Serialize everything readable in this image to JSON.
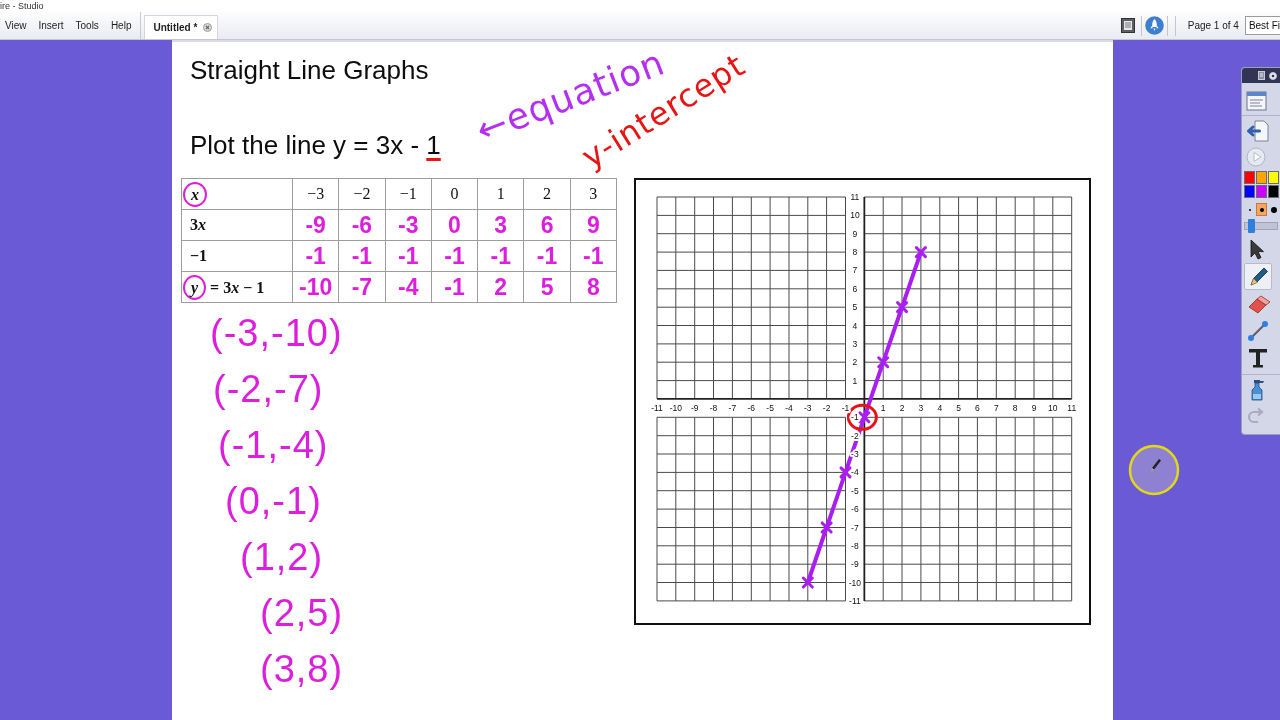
{
  "window": {
    "title": "ire - Studio"
  },
  "menu": [
    "View",
    "Insert",
    "Tools",
    "Help"
  ],
  "tabs": [
    {
      "label": "Untitled *",
      "selected": true
    }
  ],
  "page_indicator": "Page 1 of 4",
  "zoom_field": {
    "value": "Best Fi"
  },
  "page": {
    "title": "Straight Line Graphs",
    "instruction": {
      "parts": [
        {
          "text": "Plot the line y = 3x - ",
          "underlined": false
        },
        {
          "text": "1",
          "underlined": true
        }
      ]
    },
    "annotations": [
      {
        "text": "←equation",
        "color": "#b52ff0"
      },
      {
        "text": "y-intercept",
        "color": "#e81414"
      }
    ],
    "table": {
      "header": {
        "label": [
          {
            "text": "x",
            "kind": "variable",
            "circled": true
          }
        ],
        "values": [
          "−3",
          "−2",
          "−1",
          "0",
          "1",
          "2",
          "3"
        ]
      },
      "rows": [
        {
          "label": [
            {
              "text": "3",
              "kind": "constant",
              "circled": false
            },
            {
              "text": "x",
              "kind": "variable",
              "circled": false
            }
          ],
          "values": [
            "-9",
            "-6",
            "-3",
            "0",
            "3",
            "6",
            "9"
          ]
        },
        {
          "label": [
            {
              "text": "−1",
              "kind": "constant",
              "circled": false
            }
          ],
          "values": [
            "-1",
            "-1",
            "-1",
            "-1",
            "-1",
            "-1",
            "-1"
          ]
        },
        {
          "label": [
            {
              "text": "y",
              "kind": "variable",
              "circled": true
            },
            {
              "text": " = 3",
              "kind": "constant",
              "circled": false
            },
            {
              "text": "x",
              "kind": "variable",
              "circled": false
            },
            {
              "text": " − 1",
              "kind": "constant",
              "circled": false
            }
          ],
          "values": [
            "-10",
            "-7",
            "-4",
            "-1",
            "2",
            "5",
            "8"
          ]
        }
      ]
    },
    "points": [
      "(-3,-10)",
      "(-2,-7)",
      "(-1,-4)",
      "(0,-1)",
      "(1,2)",
      "(2,5)",
      "(3,8)"
    ],
    "graph": {
      "intercept_mark": {
        "color": "#e81414"
      },
      "chart_data": {
        "type": "line",
        "grid": true,
        "x": [
          -3,
          -2,
          -1,
          0,
          1,
          2,
          3
        ],
        "series": [
          {
            "color": "#aa1ef0",
            "marker": "x",
            "values": [
              -10,
              -7,
              -4,
              -1,
              2,
              5,
              8
            ]
          }
        ],
        "xlim": [
          -11,
          11
        ],
        "ylim": [
          -11,
          11
        ],
        "xticks": [
          {
            "value": -11,
            "label": "-11"
          },
          {
            "value": -10,
            "label": "-10"
          },
          {
            "value": -9,
            "label": "-9"
          },
          {
            "value": -8,
            "label": "-8"
          },
          {
            "value": -7,
            "label": "-7"
          },
          {
            "value": -6,
            "label": "-6"
          },
          {
            "value": -5,
            "label": "-5"
          },
          {
            "value": -4,
            "label": "-4"
          },
          {
            "value": -3,
            "label": "-3"
          },
          {
            "value": -2,
            "label": "-2"
          },
          {
            "value": -1,
            "label": "-1"
          },
          {
            "value": 1,
            "label": "1"
          },
          {
            "value": 2,
            "label": "2"
          },
          {
            "value": 3,
            "label": "3"
          },
          {
            "value": 4,
            "label": "4"
          },
          {
            "value": 5,
            "label": "5"
          },
          {
            "value": 6,
            "label": "6"
          },
          {
            "value": 7,
            "label": "7"
          },
          {
            "value": 8,
            "label": "8"
          },
          {
            "value": 9,
            "label": "9"
          },
          {
            "value": 10,
            "label": "10"
          },
          {
            "value": 11,
            "label": "11"
          }
        ],
        "yticks": [
          {
            "value": -11,
            "label": "-11"
          },
          {
            "value": -10,
            "label": "-10"
          },
          {
            "value": -9,
            "label": "-9"
          },
          {
            "value": -8,
            "label": "-8"
          },
          {
            "value": -7,
            "label": "-7"
          },
          {
            "value": -6,
            "label": "-6"
          },
          {
            "value": -5,
            "label": "-5"
          },
          {
            "value": -4,
            "label": "-4"
          },
          {
            "value": -3,
            "label": "-3"
          },
          {
            "value": -2,
            "label": "-2"
          },
          {
            "value": -1,
            "label": "-1"
          },
          {
            "value": 1,
            "label": "1"
          },
          {
            "value": 2,
            "label": "2"
          },
          {
            "value": 3,
            "label": "3"
          },
          {
            "value": 4,
            "label": "4"
          },
          {
            "value": 5,
            "label": "5"
          },
          {
            "value": 6,
            "label": "6"
          },
          {
            "value": 7,
            "label": "7"
          },
          {
            "value": 8,
            "label": "8"
          },
          {
            "value": 9,
            "label": "9"
          },
          {
            "value": 10,
            "label": "10"
          },
          {
            "value": 11,
            "label": "11"
          }
        ]
      }
    }
  },
  "toolbar": {
    "palette": [
      {
        "color": "#ff0000"
      },
      {
        "color": "#ffa500"
      },
      {
        "color": "#ffff00"
      },
      {
        "color": "#0000ff"
      },
      {
        "color": "#cc00ff"
      },
      {
        "color": "#000000"
      }
    ],
    "pen_sizes": [
      {
        "kind": "small",
        "selected": false
      },
      {
        "kind": "medium",
        "selected": true
      },
      {
        "kind": "large",
        "selected": false
      }
    ],
    "slider": {
      "level": 0.1
    },
    "tools": [
      {
        "kind": "pointer",
        "selected": false
      },
      {
        "kind": "pen",
        "selected": true
      },
      {
        "kind": "eraser",
        "selected": false
      },
      {
        "kind": "line",
        "selected": false
      },
      {
        "kind": "text",
        "selected": false
      }
    ]
  }
}
